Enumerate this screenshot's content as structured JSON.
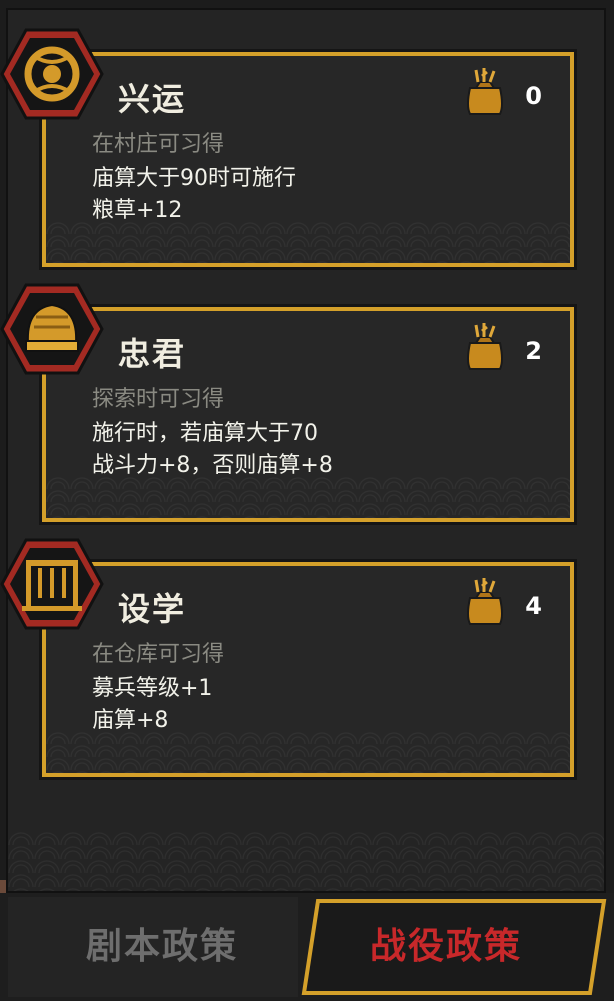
{
  "policies": [
    {
      "name": "兴运",
      "requirement": "在村庄可习得",
      "line1": "庙算大于90时可施行",
      "line2": "粮草+12",
      "cost": "0",
      "icon": "swirl-emblem-icon"
    },
    {
      "name": "忠君",
      "requirement": "探索时可习得",
      "line1": "施行时，若庙算大于70",
      "line2": "战斗力+8，否则庙算+8",
      "cost": "2",
      "icon": "crown-helmet-icon"
    },
    {
      "name": "设学",
      "requirement": "在仓库可习得",
      "line1": "募兵等级+1",
      "line2": "庙算+8",
      "cost": "4",
      "icon": "bell-rack-icon"
    }
  ],
  "tabs": {
    "script_policy": "剧本政策",
    "campaign_policy": "战役政策",
    "active": "campaign_policy"
  },
  "colors": {
    "gold_border": "#d4a02a",
    "hex_red": "#a32a22",
    "active_tab_text": "#c8282a",
    "inactive_tab_text": "#6e6e6e"
  },
  "cost_icon": "grain-sack-icon"
}
